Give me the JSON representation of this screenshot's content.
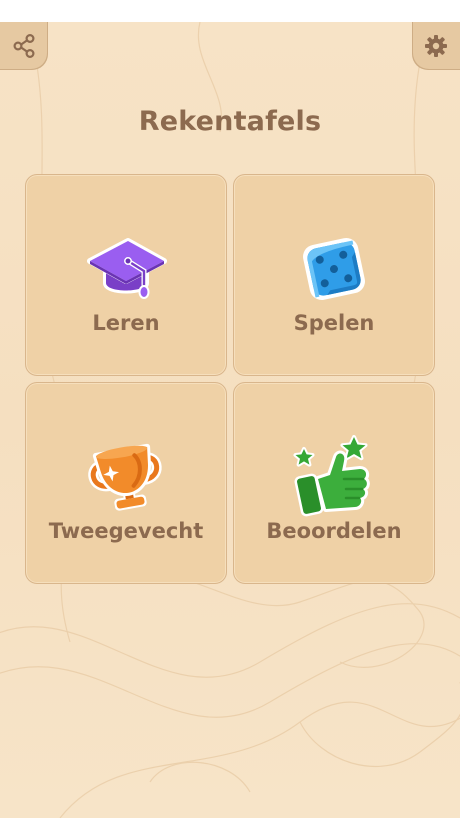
{
  "app": {
    "title": "Rekentafels"
  },
  "toolbar": {
    "share_icon": "share-icon",
    "settings_icon": "gear-icon"
  },
  "menu": [
    {
      "label": "Leren",
      "icon": "graduation-cap-icon",
      "color": "#8f4fe0"
    },
    {
      "label": "Spelen",
      "icon": "dice-icon",
      "color": "#2f9de8"
    },
    {
      "label": "Tweegevecht",
      "icon": "trophy-icon",
      "color": "#f28b2a"
    },
    {
      "label": "Beoordelen",
      "icon": "thumbs-up-icon",
      "color": "#3cae3c"
    }
  ],
  "colors": {
    "background": "#f6e1c3",
    "tile": "#efd1a6",
    "text": "#8c6a4f"
  }
}
